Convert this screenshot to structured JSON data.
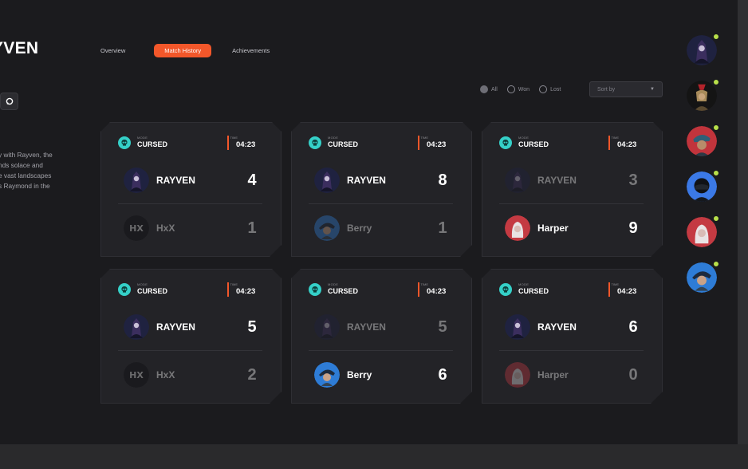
{
  "profile": {
    "name": "YVEN",
    "bio_lines": [
      "y with Rayven, the",
      "nds solace and",
      "e vast landscapes",
      "s Raymond in the"
    ]
  },
  "tabs": [
    {
      "label": "Overview",
      "active": false
    },
    {
      "label": "Match History",
      "active": true
    },
    {
      "label": "Achievements",
      "active": false
    }
  ],
  "filters": {
    "options": [
      {
        "label": "All",
        "checked": true
      },
      {
        "label": "Won",
        "checked": false
      },
      {
        "label": "Lost",
        "checked": false
      }
    ],
    "sort_label": "Sort by"
  },
  "accent": "#f3572a",
  "mode_color": "#35d0c8",
  "matches": [
    {
      "mode_label": "MODE",
      "mode": "CURSED",
      "time_label": "TIME",
      "time": "04:23",
      "p1": {
        "name": "RAYVEN",
        "score": "4",
        "dim": false,
        "avatar": "rayven"
      },
      "p2": {
        "name": "HxX",
        "score": "1",
        "dim": true,
        "avatar": "hxx"
      }
    },
    {
      "mode_label": "MODE",
      "mode": "CURSED",
      "time_label": "TIME",
      "time": "04:23",
      "p1": {
        "name": "RAYVEN",
        "score": "8",
        "dim": false,
        "avatar": "rayven"
      },
      "p2": {
        "name": "Berry",
        "score": "1",
        "dim": true,
        "avatar": "berry"
      }
    },
    {
      "mode_label": "MODE",
      "mode": "CURSED",
      "time_label": "TIME",
      "time": "04:23",
      "p1": {
        "name": "RAYVEN",
        "score": "3",
        "dim": true,
        "avatar": "rayven"
      },
      "p2": {
        "name": "Harper",
        "score": "9",
        "dim": false,
        "avatar": "harper"
      }
    },
    {
      "mode_label": "MODE",
      "mode": "CURSED",
      "time_label": "TIME",
      "time": "04:23",
      "p1": {
        "name": "RAYVEN",
        "score": "5",
        "dim": false,
        "avatar": "rayven"
      },
      "p2": {
        "name": "HxX",
        "score": "2",
        "dim": true,
        "avatar": "hxx"
      }
    },
    {
      "mode_label": "MODE",
      "mode": "CURSED",
      "time_label": "TIME",
      "time": "04:23",
      "p1": {
        "name": "RAYVEN",
        "score": "5",
        "dim": true,
        "avatar": "rayven"
      },
      "p2": {
        "name": "Berry",
        "score": "6",
        "dim": false,
        "avatar": "berry"
      }
    },
    {
      "mode_label": "MODE",
      "mode": "CURSED",
      "time_label": "TIME",
      "time": "04:23",
      "p1": {
        "name": "RAYVEN",
        "score": "6",
        "dim": false,
        "avatar": "rayven"
      },
      "p2": {
        "name": "Harper",
        "score": "0",
        "dim": true,
        "avatar": "harper"
      }
    }
  ],
  "friends": [
    {
      "avatar": "rayven",
      "online": true
    },
    {
      "avatar": "spartan",
      "online": true
    },
    {
      "avatar": "capred",
      "online": true
    },
    {
      "avatar": "helmet",
      "online": true
    },
    {
      "avatar": "harper",
      "online": true
    },
    {
      "avatar": "berry",
      "online": true
    }
  ]
}
